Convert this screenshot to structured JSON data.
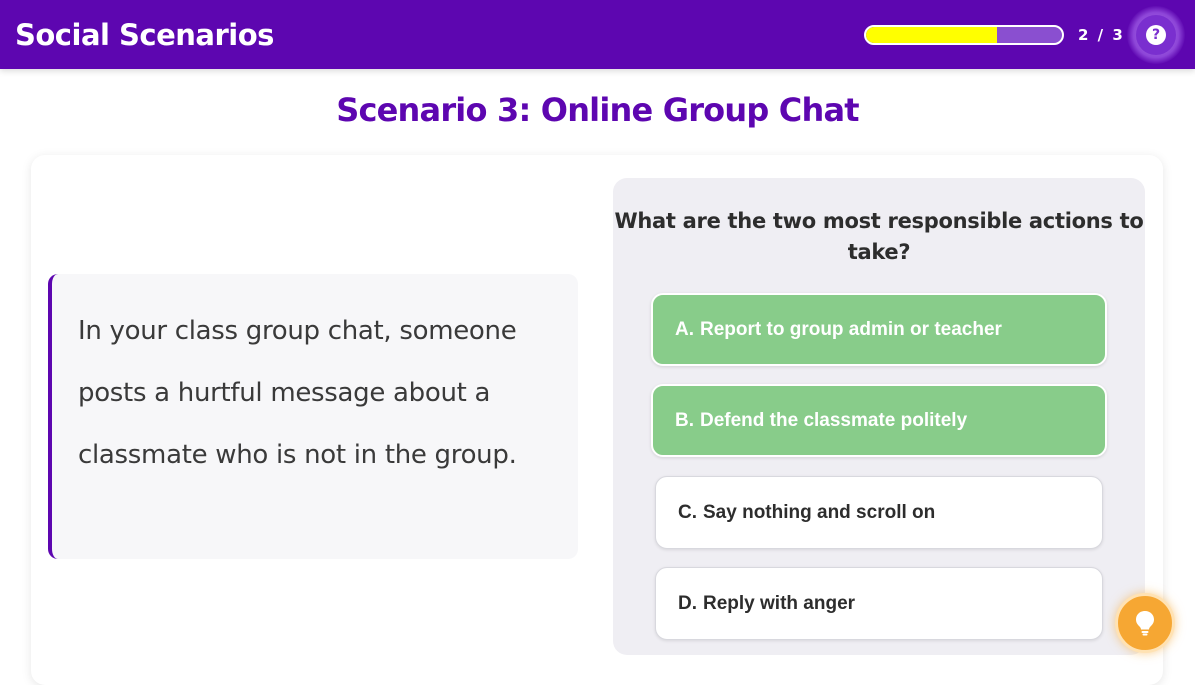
{
  "header": {
    "app_title": "Social Scenarios",
    "progress_count": "2 / 3",
    "progress_fraction": 0.67,
    "help_icon_glyph": "?"
  },
  "scenario": {
    "title": "Scenario 3: Online Group Chat",
    "story": "In your class group chat, someone posts a hurtful message about a classmate who is not in the group."
  },
  "question": {
    "text": "What are the two most responsible actions to take?",
    "options": [
      {
        "letter": "A.",
        "label": "Report to group admin or teacher",
        "selected": true
      },
      {
        "letter": "B.",
        "label": "Defend the classmate politely",
        "selected": true
      },
      {
        "letter": "C.",
        "label": "Say nothing and scroll on",
        "selected": false
      },
      {
        "letter": "D.",
        "label": "Reply with anger",
        "selected": false
      }
    ]
  },
  "colors": {
    "brand_purple": "#5d06b0",
    "progress_fill": "#ffff00",
    "selected_green": "#88cc8a",
    "hint_orange": "#f6a733"
  },
  "icons": {
    "help": "help-icon",
    "hint": "lightbulb-icon"
  }
}
